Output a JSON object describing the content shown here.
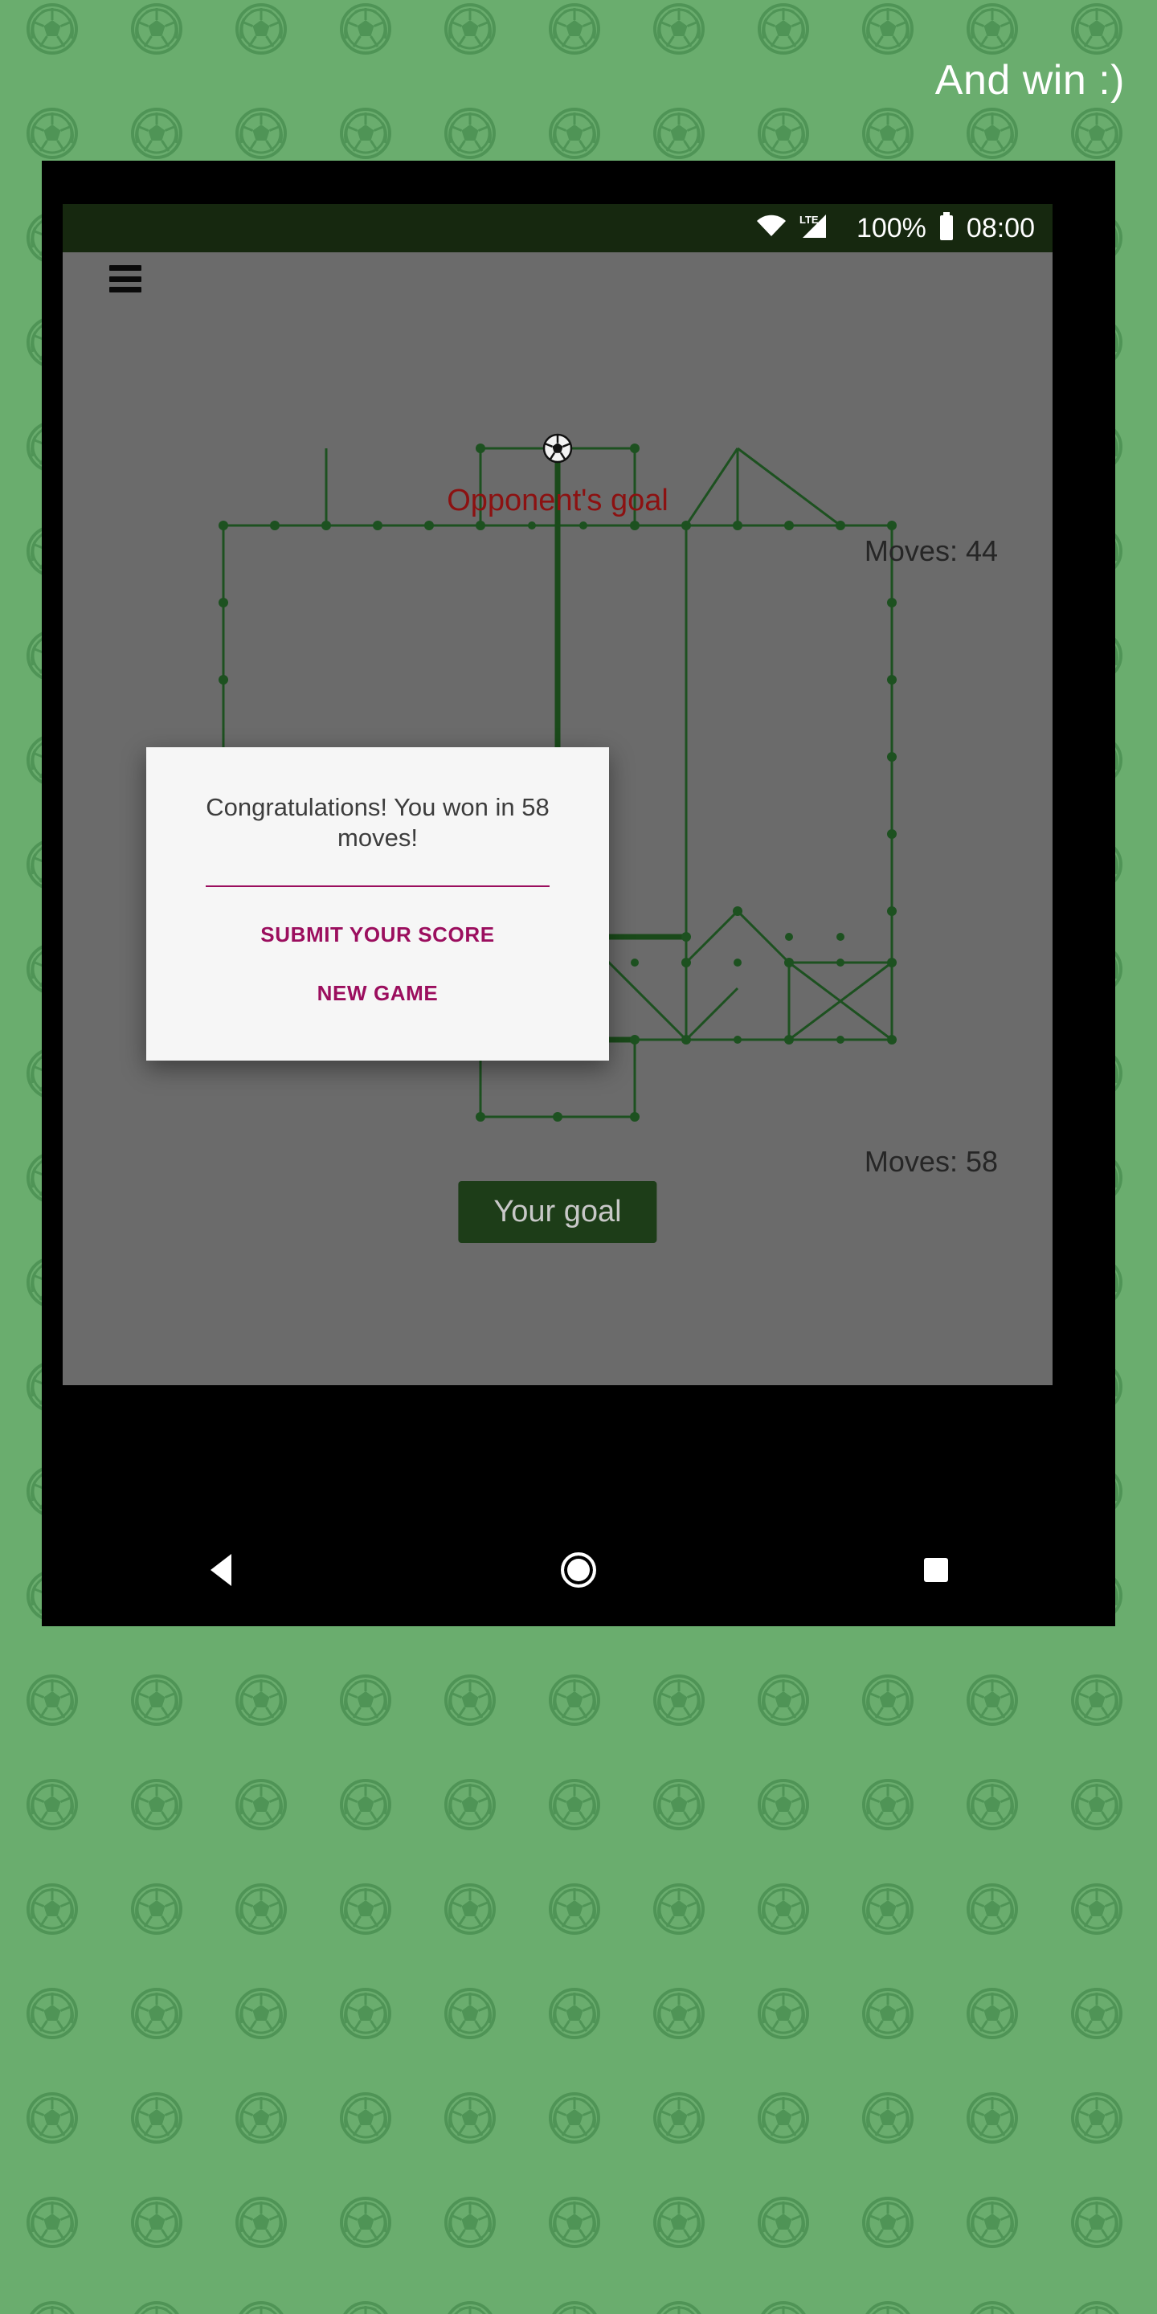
{
  "banner": {
    "caption": "And win :)",
    "text_color": "#ffffff",
    "background_color": "#6aad6e",
    "pattern_icon": "soccer-ball-icon"
  },
  "status_bar": {
    "background_color": "#16280f",
    "wifi_icon": "wifi-icon",
    "network_label": "LTE",
    "signal_icon": "signal-bars-icon",
    "battery_percent": "100%",
    "battery_icon": "battery-full-icon",
    "clock": "08:00"
  },
  "app_bar": {
    "menu_icon": "hamburger-menu-icon"
  },
  "board": {
    "background_color": "#6b6b6b",
    "line_color": "#1d5120",
    "opponent_goal_label": "Opponent's goal",
    "opponent_goal_color": "#8c1111",
    "your_goal_label": "Your goal",
    "your_goal_bg": "#1d3d18",
    "your_goal_text_color": "#c8c8c8",
    "moves_top": "Moves: 44",
    "moves_bottom": "Moves: 58",
    "moves_color": "#262626",
    "ball_icon": "soccer-ball-icon"
  },
  "dialog": {
    "message": "Congratulations! You won in 58 moves!",
    "message_color": "#3d3d3d",
    "background_color": "#f6f6f6",
    "accent_color": "#9b0e5e",
    "buttons": [
      {
        "label": "SUBMIT YOUR SCORE",
        "name": "submit-score-button"
      },
      {
        "label": "NEW GAME",
        "name": "new-game-button"
      }
    ]
  },
  "nav_bar": {
    "background_color": "#000000",
    "back_icon": "back-triangle-icon",
    "home_icon": "home-circle-icon",
    "recents_icon": "recents-square-icon"
  }
}
